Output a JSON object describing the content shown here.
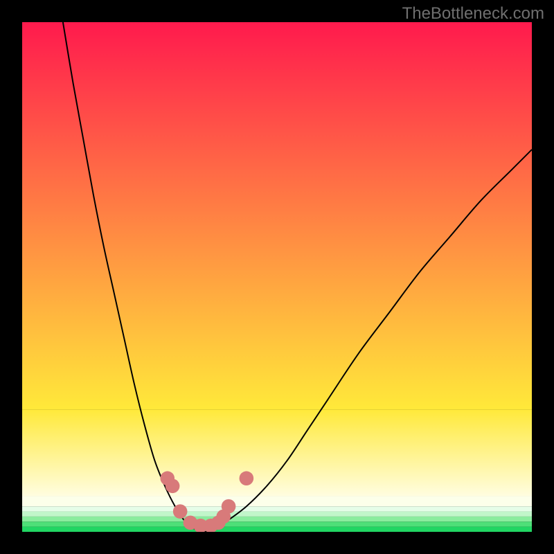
{
  "watermark": "TheBottleneck.com",
  "chart_data": {
    "type": "line",
    "title": "",
    "xlabel": "",
    "ylabel": "",
    "xlim": [
      0,
      100
    ],
    "ylim": [
      0,
      100
    ],
    "series": [
      {
        "name": "curve-left",
        "x": [
          8,
          10,
          12,
          14,
          16,
          18,
          20,
          22,
          24,
          26,
          28,
          30,
          32,
          34,
          36
        ],
        "values": [
          100,
          88,
          77,
          66,
          56,
          47,
          38,
          29,
          21,
          14,
          9,
          5,
          2,
          0.5,
          0
        ]
      },
      {
        "name": "curve-right",
        "x": [
          36,
          38,
          40,
          44,
          48,
          52,
          56,
          60,
          66,
          72,
          78,
          84,
          90,
          96,
          100
        ],
        "values": [
          0,
          0.8,
          2,
          5,
          9,
          14,
          20,
          26,
          35,
          43,
          51,
          58,
          65,
          71,
          75
        ]
      }
    ],
    "markers": {
      "name": "points",
      "x": [
        28.5,
        29.5,
        31,
        33,
        35,
        37,
        38.5,
        39.5,
        40.5,
        44
      ],
      "values": [
        10.5,
        9,
        4,
        1.8,
        1.2,
        1.2,
        1.8,
        3,
        5,
        10.5
      ],
      "color": "#d87a7a"
    },
    "gradient_bands": [
      {
        "y0": 100,
        "y1": 24,
        "stops": [
          [
            "0%",
            "#ff1a4d"
          ],
          [
            "100%",
            "#ffe93a"
          ]
        ]
      },
      {
        "y0": 24,
        "y1": 7,
        "stops": [
          [
            "0%",
            "#ffe93a"
          ],
          [
            "100%",
            "#fffde0"
          ]
        ]
      },
      {
        "y0": 7,
        "y1": 5,
        "color": "#fcffea"
      },
      {
        "y0": 5,
        "y1": 4,
        "color": "#e5fde8"
      },
      {
        "y0": 4,
        "y1": 3,
        "color": "#c1f6ca"
      },
      {
        "y0": 3,
        "y1": 2,
        "color": "#8aec9e"
      },
      {
        "y0": 2,
        "y1": 1,
        "color": "#4edf78"
      },
      {
        "y0": 1,
        "y1": 0,
        "color": "#21d663"
      }
    ]
  }
}
